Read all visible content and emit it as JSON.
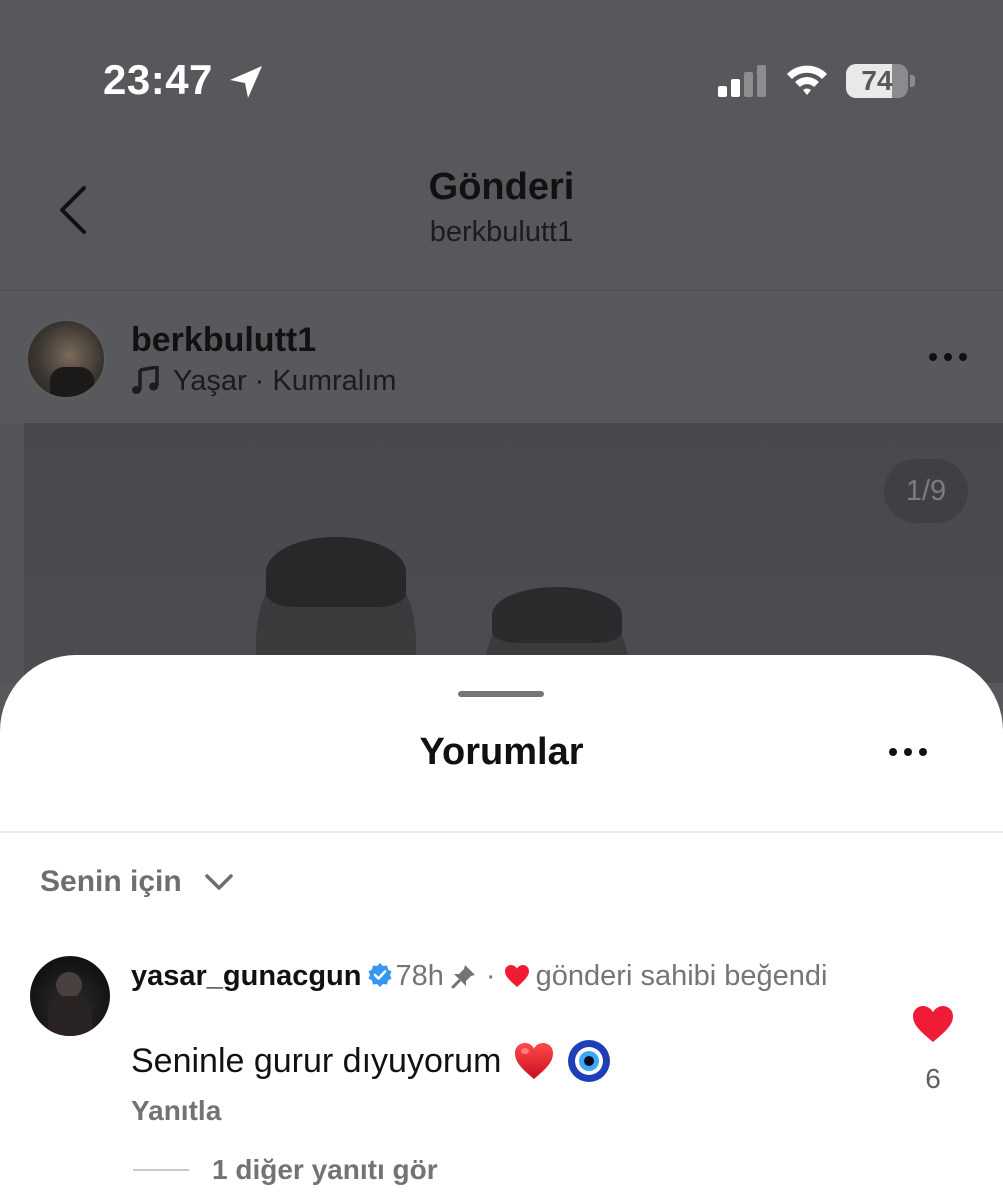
{
  "status_bar": {
    "time": "23:47",
    "battery_level": "74",
    "battery_fraction": 0.74
  },
  "nav": {
    "title": "Gönderi",
    "subtitle": "berkbulutt1"
  },
  "post": {
    "username": "berkbulutt1",
    "music": "Yaşar · Kumralım",
    "image_counter": "1/9"
  },
  "comments": {
    "title": "Yorumlar",
    "filter_label": "Senin için",
    "items": [
      {
        "username": "yasar_gunacgun",
        "verified": true,
        "time": "78h",
        "liked_by_owner": "gönderi sahibi beğendi",
        "text": "Seninle gurur dıyuyorum",
        "reply_label": "Yanıtla",
        "like_count": "6",
        "more_replies": "1 diğer yanıtı gör"
      }
    ]
  },
  "colors": {
    "like_red": "#f01c36",
    "verified_blue": "#3797f0",
    "scrim": "#56585b"
  },
  "icons": [
    "location-arrow-icon",
    "signal-icon",
    "wifi-icon",
    "battery-icon",
    "back-chevron-icon",
    "music-note-icon",
    "more-dots-icon",
    "chevron-down-icon",
    "verified-badge-icon",
    "pin-icon",
    "heart-icon",
    "nazar-eye-icon"
  ]
}
